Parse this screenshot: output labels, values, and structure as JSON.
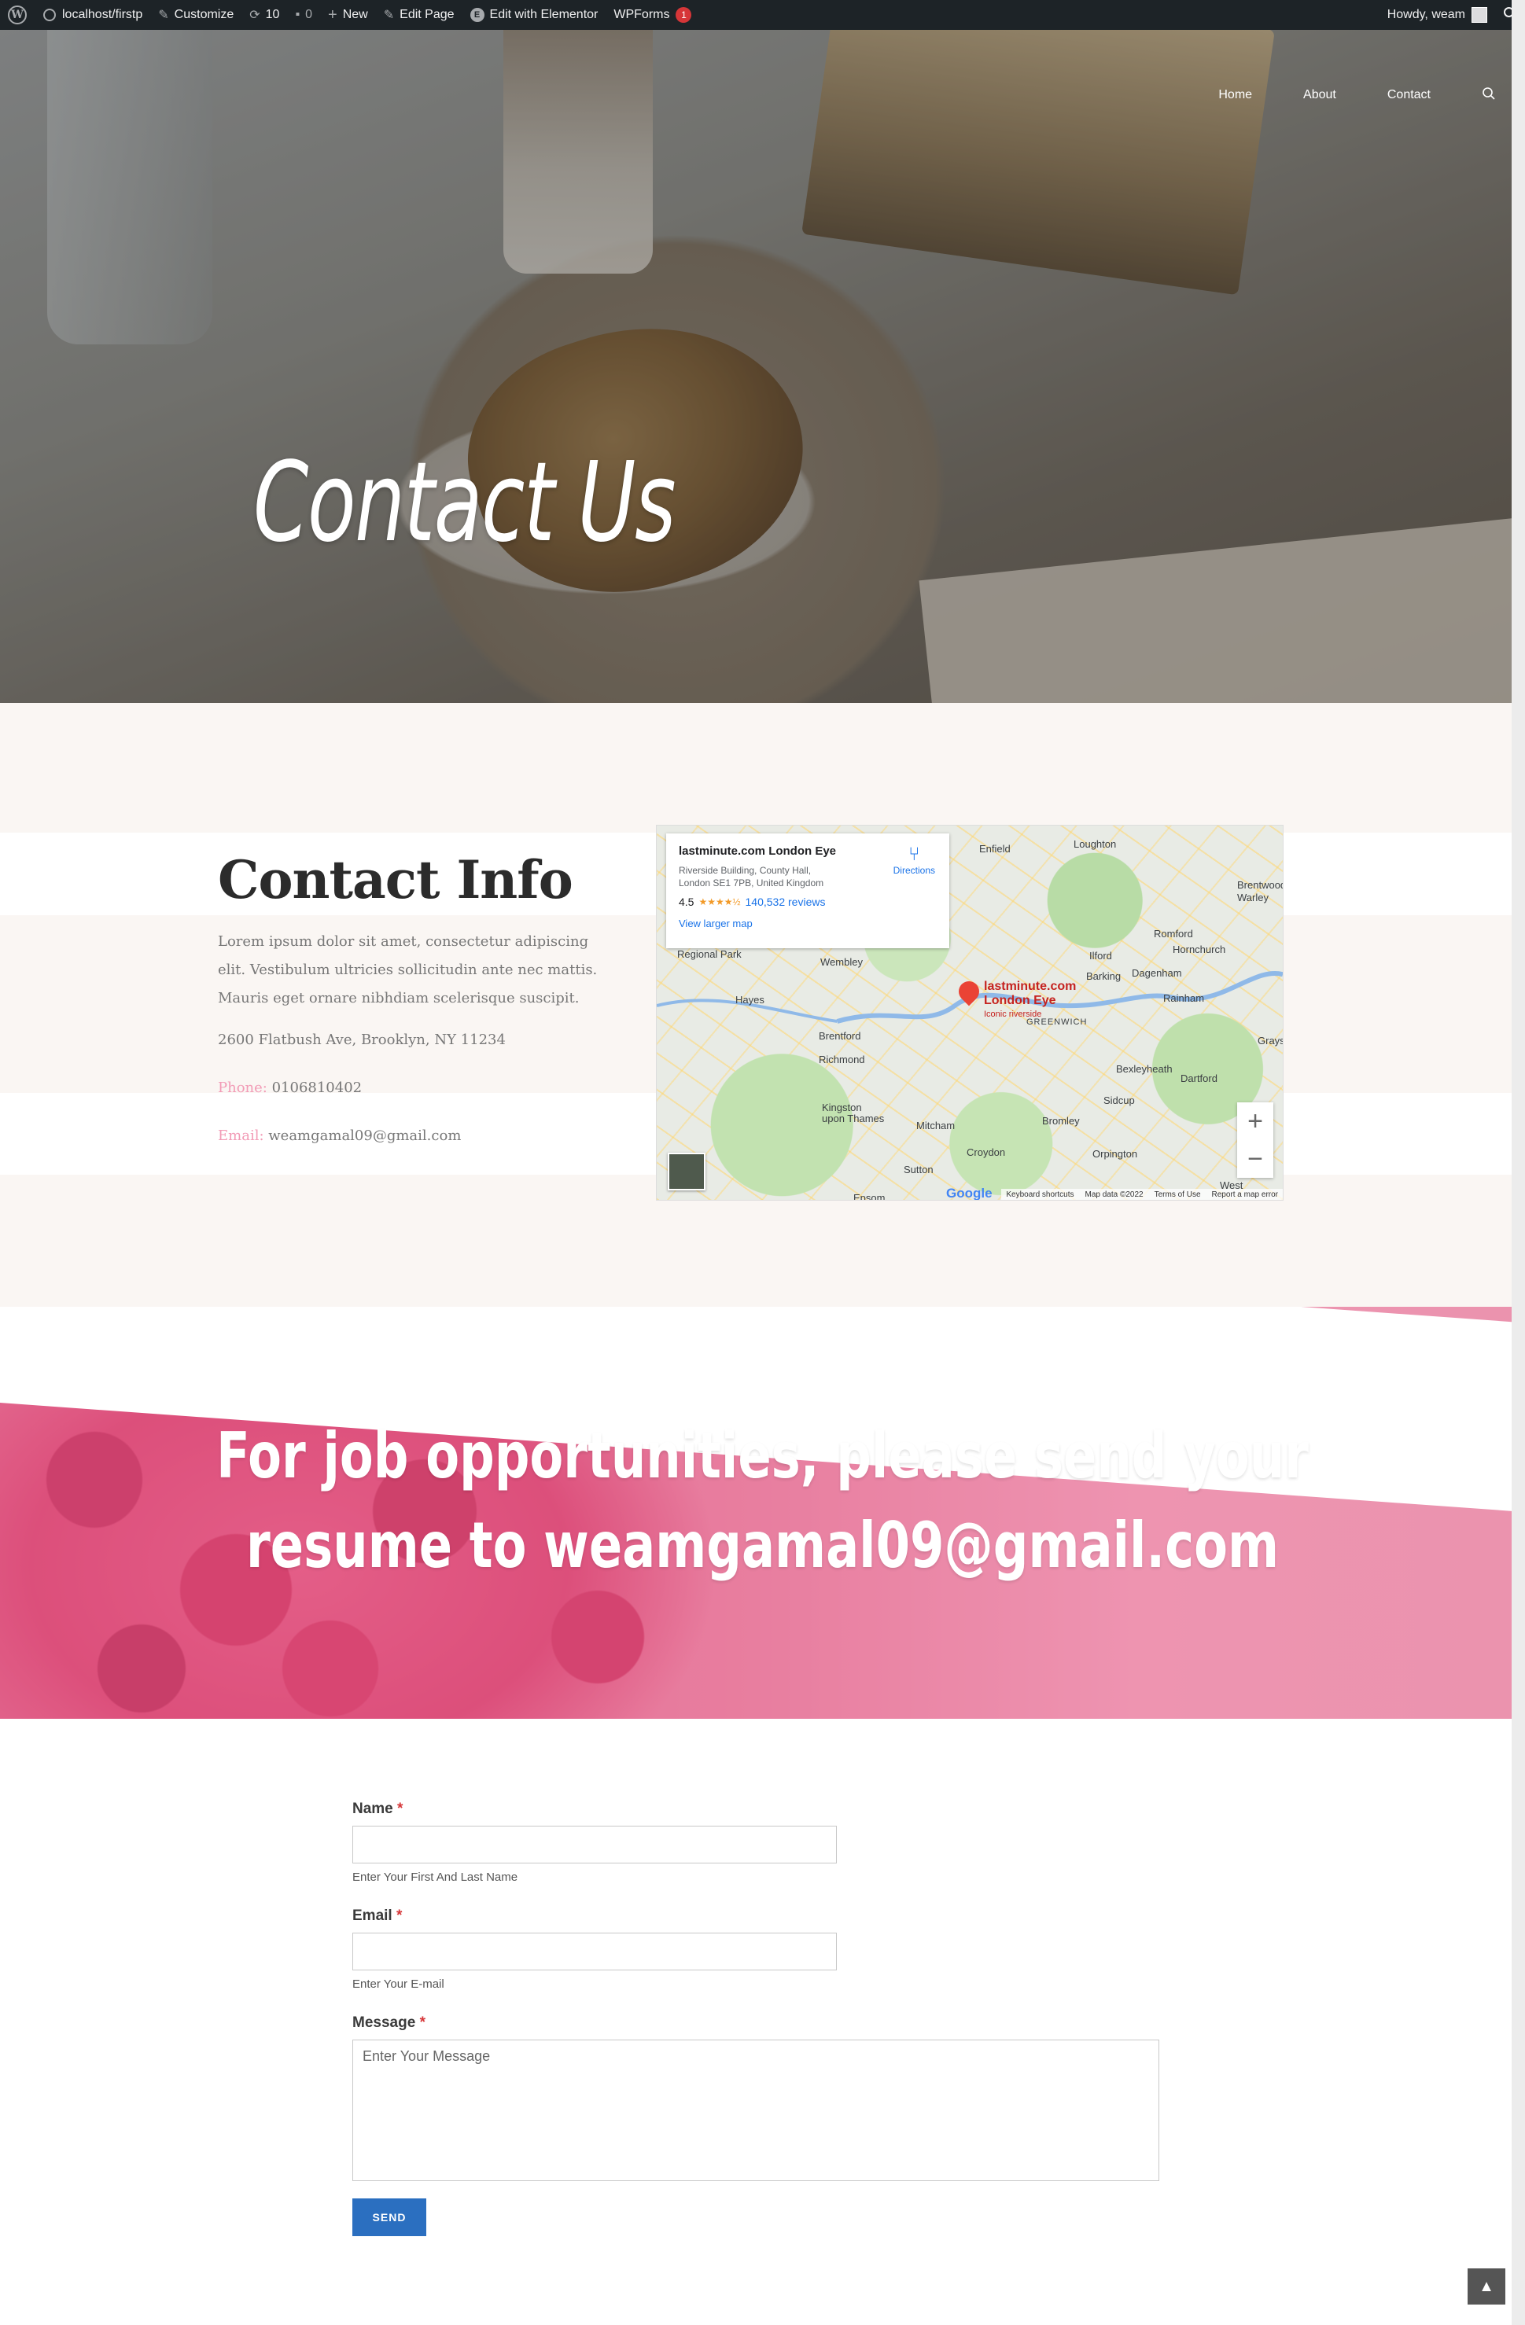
{
  "adminbar": {
    "site": "localhost/firstp",
    "customize": "Customize",
    "updates_count": "10",
    "comments_count": "0",
    "new": "New",
    "edit_page": "Edit Page",
    "edit_elementor": "Edit with Elementor",
    "wpforms": "WPForms",
    "wpforms_badge": "1",
    "howdy": "Howdy, weam"
  },
  "nav": {
    "items": [
      "Home",
      "About",
      "Contact"
    ]
  },
  "hero": {
    "title": "Contact Us"
  },
  "contact": {
    "heading": "Contact Info",
    "lorem": "Lorem ipsum dolor sit amet, consectetur adipiscing elit. Vestibulum ultricies sollicitudin ante nec mattis. Mauris eget ornare nibhdiam scelerisque suscipit.",
    "address": "2600 Flatbush Ave, Brooklyn, NY 11234",
    "phone_label": "Phone:",
    "phone": "0106810402",
    "email_label": "Email:",
    "email": "weamgamal09@gmail.com"
  },
  "map": {
    "place": "lastminute.com London Eye",
    "address_1": "Riverside Building, County Hall,",
    "address_2": "London SE1 7PB, United Kingdom",
    "rating": "4.5",
    "stars": "★★★★½",
    "reviews": "140,532 reviews",
    "view_larger": "View larger map",
    "directions": "Directions",
    "pin_label_1": "lastminute.com",
    "pin_label_2": "London Eye",
    "pin_sub": "Iconic riverside",
    "google": "Google",
    "footer": [
      "Keyboard shortcuts",
      "Map data ©2022",
      "Terms of Use",
      "Report a map error"
    ],
    "towns": [
      "Enfield",
      "Loughton",
      "Brentwood",
      "Romford",
      "Hornchurch",
      "Ilford",
      "Barking",
      "Dagenham",
      "Rainham",
      "Wembley",
      "Hayes",
      "Brentford",
      "Richmond",
      "Kingston upon Thames",
      "Mitcham",
      "Croydon",
      "Bromley",
      "Sidcup",
      "Bexleyheath",
      "Dartford",
      "Orpington",
      "Sutton",
      "Regional Park",
      "GREENWICH",
      "Epsom",
      "West",
      "Warley",
      "Grays"
    ]
  },
  "banner": {
    "line1": "For job opportunities, please send your",
    "line2": "resume to weamgamal09@gmail.com"
  },
  "form": {
    "name_label": "Name",
    "name_hint": "Enter Your First And Last Name",
    "email_label": "Email",
    "email_hint": "Enter Your E-mail",
    "message_label": "Message",
    "message_placeholder": "Enter Your Message",
    "required_mark": "*",
    "send": "SEND"
  },
  "colors": {
    "admin_bar": "#1d2327",
    "accent_pink": "#f29bb6",
    "button_blue": "#2b6fc0",
    "section_bg": "#faf6f3"
  }
}
